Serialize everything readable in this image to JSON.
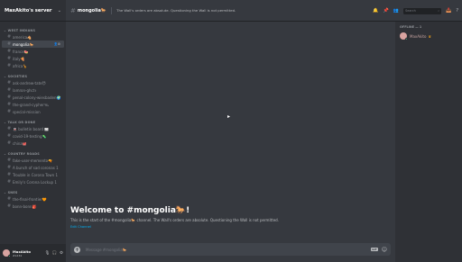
{
  "server": {
    "name": "MaxAkito's server",
    "chevron_icon": "chevron-down-icon"
  },
  "categories": [
    {
      "name": "WEST INDIANS",
      "channels": [
        {
          "name": "america🐴",
          "active": false
        },
        {
          "name": "mongolia🐎",
          "active": true
        },
        {
          "name": "france🍉",
          "active": false
        },
        {
          "name": "italy🍕",
          "active": false
        },
        {
          "name": "africa🦒",
          "active": false
        }
      ]
    },
    {
      "name": "SOCIETIES",
      "channels": [
        {
          "name": "ask-andrew-tate😈",
          "active": false
        },
        {
          "name": "lamron-ghct⚕",
          "active": false
        },
        {
          "name": "penal-colony-wiesbaden🌍",
          "active": false
        },
        {
          "name": "the-grand-cypher🛰",
          "active": false
        },
        {
          "name": "special-mission",
          "active": false
        }
      ]
    },
    {
      "name": "TALK OR DONE",
      "channels": [
        {
          "name": "🚇 bulletin board 📰",
          "active": false
        },
        {
          "name": "covid-19-testing🦠",
          "active": false
        },
        {
          "name": "china🐙",
          "active": false
        }
      ]
    },
    {
      "name": "COUNTRY ROADS",
      "channels": [
        {
          "name": "fake-user-memento🔫",
          "active": false
        },
        {
          "name": "A bunch of sad coronas 1",
          "active": false
        },
        {
          "name": "Trouble in Corona Town 1",
          "active": false
        },
        {
          "name": "Emily's Corona Lockup 1",
          "active": false
        }
      ]
    },
    {
      "name": "SNES",
      "channels": [
        {
          "name": "the-final-frontier🧡",
          "active": false
        },
        {
          "name": "bonn-bonn🎒",
          "active": false
        }
      ]
    }
  ],
  "user": {
    "name": "MaxAkito",
    "tag": "#1234"
  },
  "channel": {
    "name": "mongolia🐎",
    "topic": "The Wall's orders are absolute. Questioning the Wall is not permitted."
  },
  "welcome": {
    "title": "Welcome to #mongolia🐎!",
    "subtitle": "This is the start of the #mongolia🐎 channel. The Wall's orders are absolute. Questioning the Wall is not permitted.",
    "edit_link": "Edit Channel"
  },
  "composer": {
    "placeholder": "Message #mongolia🐎",
    "gif_label": "GIF"
  },
  "search": {
    "placeholder": "Search"
  },
  "members": {
    "category": "OFFLINE — 1",
    "list": [
      {
        "name": "MaxAkito"
      }
    ]
  }
}
